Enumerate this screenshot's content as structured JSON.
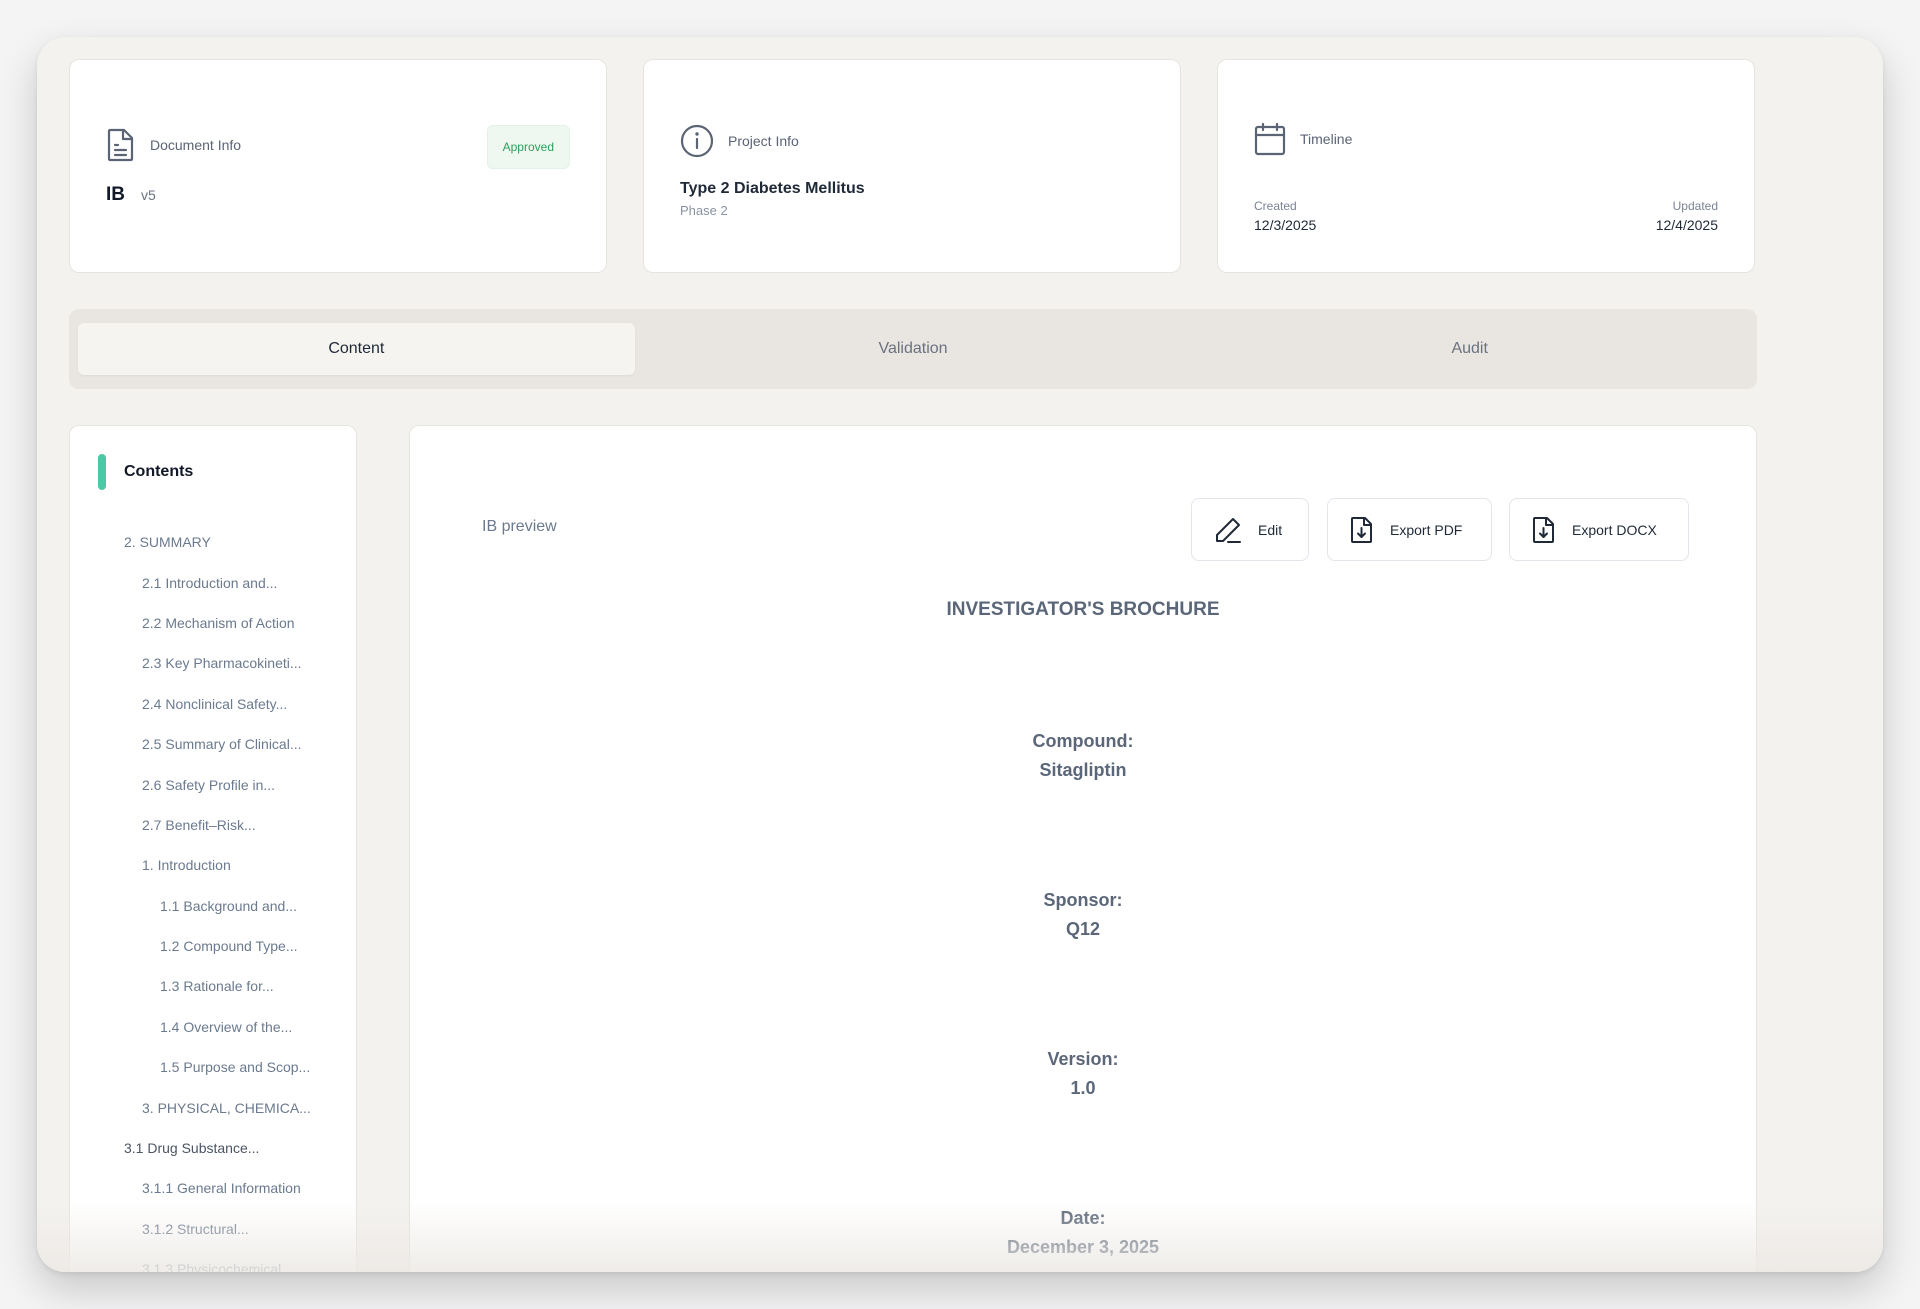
{
  "document_info": {
    "label": "Document Info",
    "status": "Approved",
    "type": "IB",
    "version": "v5"
  },
  "project_info": {
    "label": "Project Info",
    "title": "Type 2 Diabetes Mellitus",
    "phase": "Phase 2"
  },
  "timeline": {
    "label": "Timeline",
    "created_label": "Created",
    "created": "12/3/2025",
    "updated_label": "Updated",
    "updated": "12/4/2025"
  },
  "tabs": [
    {
      "label": "Content",
      "active": true
    },
    {
      "label": "Validation",
      "active": false
    },
    {
      "label": "Audit",
      "active": false
    }
  ],
  "toc": {
    "title": "Contents",
    "accent": "#4ec7a4",
    "items": [
      {
        "label": "2. SUMMARY",
        "level": 0
      },
      {
        "label": "2.1 Introduction and...",
        "level": 1
      },
      {
        "label": "2.2 Mechanism of Action",
        "level": 1
      },
      {
        "label": "2.3 Key Pharmacokineti...",
        "level": 1
      },
      {
        "label": "2.4 Nonclinical Safety...",
        "level": 1
      },
      {
        "label": "2.5 Summary of Clinical...",
        "level": 1
      },
      {
        "label": "2.6 Safety Profile in...",
        "level": 1
      },
      {
        "label": "2.7 Benefit–Risk...",
        "level": 1
      },
      {
        "label": "1. Introduction",
        "level": 1
      },
      {
        "label": "1.1 Background and...",
        "level": 2
      },
      {
        "label": "1.2 Compound Type...",
        "level": 2
      },
      {
        "label": "1.3 Rationale for...",
        "level": 2
      },
      {
        "label": "1.4 Overview of the...",
        "level": 2
      },
      {
        "label": "1.5 Purpose and Scop...",
        "level": 2
      },
      {
        "label": "3. PHYSICAL, CHEMICA...",
        "level": 1
      },
      {
        "label": "3.1 Drug Substance...",
        "level": 0
      },
      {
        "label": "3.1.1 General Information",
        "level": 1
      },
      {
        "label": "3.1.2 Structural...",
        "level": 1
      },
      {
        "label": "3.1.3 Physicochemical...",
        "level": 1
      }
    ]
  },
  "preview": {
    "label": "IB preview",
    "edit_label": "Edit",
    "export_pdf_label": "Export PDF",
    "export_docx_label": "Export DOCX",
    "doc_title": "INVESTIGATOR'S BROCHURE",
    "fields": [
      {
        "key": "Compound:",
        "value": "Sitagliptin"
      },
      {
        "key": "Sponsor:",
        "value": "Q12"
      },
      {
        "key": "Version:",
        "value": "1.0"
      },
      {
        "key": "Date:",
        "value": "December 3, 2025"
      }
    ]
  },
  "colors": {
    "approved_bg": "#eef8f1",
    "approved_text": "#2f9e5a",
    "accent": "#4ec7a4"
  }
}
